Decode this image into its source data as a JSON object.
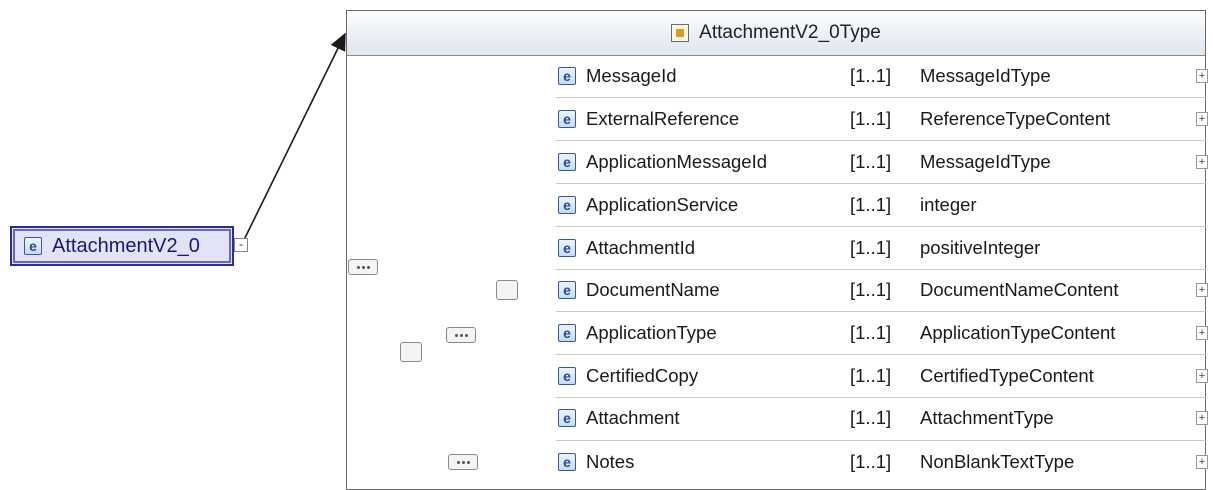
{
  "root_element": {
    "label": "AttachmentV2_0",
    "icon": "element-icon",
    "toggle": "-"
  },
  "type_box": {
    "title": "AttachmentV2_0Type",
    "icon": "complex-type-icon"
  },
  "rows": [
    {
      "name": "MessageId",
      "card": "[1..1]",
      "type": "MessageIdType",
      "expand": "+"
    },
    {
      "name": "ExternalReference",
      "card": "[1..1]",
      "type": "ReferenceTypeContent",
      "expand": "+"
    },
    {
      "name": "ApplicationMessageId",
      "card": "[1..1]",
      "type": "MessageIdType",
      "expand": "+"
    },
    {
      "name": "ApplicationService",
      "card": "[1..1]",
      "type": "integer",
      "expand": ""
    },
    {
      "name": "AttachmentId",
      "card": "[1..1]",
      "type": "positiveInteger",
      "expand": ""
    },
    {
      "name": "DocumentName",
      "card": "[1..1]",
      "type": "DocumentNameContent",
      "expand": "+"
    },
    {
      "name": "ApplicationType",
      "card": "[1..1]",
      "type": "ApplicationTypeContent",
      "expand": "+"
    },
    {
      "name": "CertifiedCopy",
      "card": "[1..1]",
      "type": "CertifiedTypeContent",
      "expand": "+"
    },
    {
      "name": "Attachment",
      "card": "[1..1]",
      "type": "AttachmentType",
      "expand": "+"
    },
    {
      "name": "Notes",
      "card": "[1..1]",
      "type": "NonBlankTextType",
      "expand": "+"
    }
  ],
  "element_icon_glyph": "e",
  "colors": {
    "element_border": "#2b2b9a",
    "element_fill": "#e3e3f7",
    "link_line": "#1a1a1a"
  }
}
